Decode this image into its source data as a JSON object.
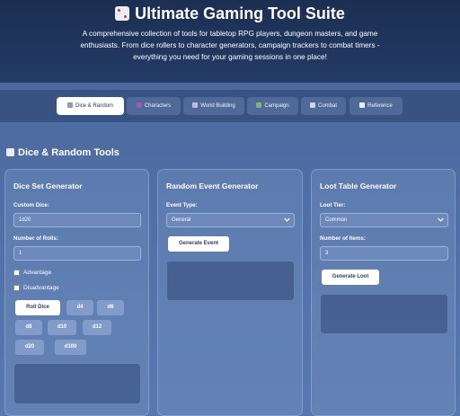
{
  "header": {
    "title": "Ultimate Gaming Tool Suite",
    "subtitle_lines": [
      "A comprehensive collection of tools for tabletop RPG players, dungeon masters, and game",
      "enthusiasts. From dice rollers to character generators, campaign trackers to combat timers -",
      "everything you need for your gaming sessions in one place!"
    ]
  },
  "tabs": [
    {
      "label": "Dice & Random",
      "icon": "dice-icon",
      "active": true
    },
    {
      "label": "Characters",
      "icon": "character-icon",
      "active": false
    },
    {
      "label": "World Building",
      "icon": "castle-icon",
      "active": false
    },
    {
      "label": "Campaign",
      "icon": "map-icon",
      "active": false
    },
    {
      "label": "Combat",
      "icon": "swords-icon",
      "active": false
    },
    {
      "label": "Reference",
      "icon": "book-icon",
      "active": false
    }
  ],
  "section": {
    "title": "Dice & Random Tools",
    "icon": "dice-icon"
  },
  "dice_set": {
    "title": "Dice Set Generator",
    "custom_dice_label": "Custom Dice:",
    "custom_dice_value": "1d20",
    "rolls_label": "Number of Rolls:",
    "rolls_value": "1",
    "advantage_label": "Advantage",
    "disadvantage_label": "Disadvantage",
    "roll_button": "Roll Dice",
    "dice_buttons": [
      "d4",
      "d6",
      "d8",
      "d10",
      "d12",
      "d20",
      "d100"
    ]
  },
  "random_event": {
    "title": "Random Event Generator",
    "type_label": "Event Type:",
    "type_value": "General",
    "button": "Generate Event"
  },
  "loot": {
    "title": "Loot Table Generator",
    "tier_label": "Loot Tier:",
    "tier_value": "Common",
    "items_label": "Number of Items:",
    "items_value": "3",
    "button": "Generate Loot"
  },
  "colors": {
    "header_bg": "#1c2f52",
    "page_bg": "#4f6fa6",
    "accent_white": "#ffffff",
    "text_dark": "#2c3e66"
  }
}
